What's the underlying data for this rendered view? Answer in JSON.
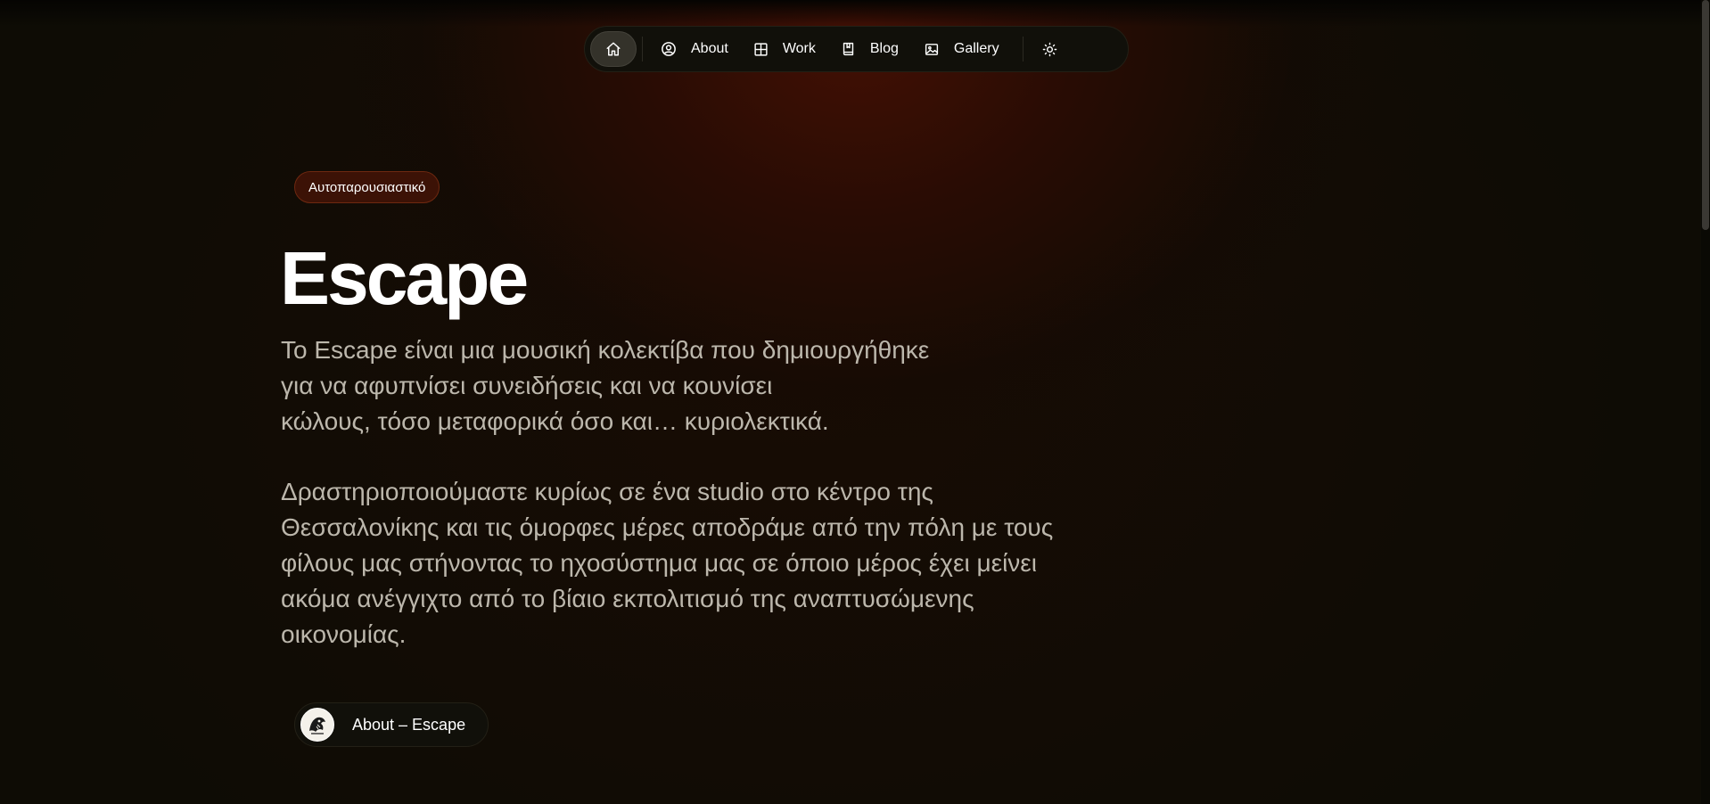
{
  "nav": {
    "home_icon": "home-icon",
    "items": [
      {
        "label": "About",
        "icon": "person-circle-icon"
      },
      {
        "label": "Work",
        "icon": "grid-icon"
      },
      {
        "label": "Blog",
        "icon": "book-icon"
      },
      {
        "label": "Gallery",
        "icon": "image-icon"
      }
    ],
    "theme_icon": "sun-icon"
  },
  "hero": {
    "badge": "Αυτοπαρουσιαστικό",
    "title": "Escape",
    "paragraph1": "Το Escape είναι μια μουσική κολεκτίβα που δημιουργήθηκε\nγια να αφυπνίσει συνειδήσεις και να κουνίσει\nκώλους, τόσο μεταφορικά όσο και… κυριολεκτικά.",
    "paragraph2": "Δραστηριοποιούμαστε κυρίως σε ένα studio στο κέντρο της\nΘεσσαλονίκης και τις όμορφες μέρες αποδράμε από την πόλη με τους\nφίλους μας στήνοντας το ηχοσύστημα μας σε όποιο μέρος έχει μείνει\nακόμα ανέγγιχτο από το βίαιο εκπολιτισμό της αναπτυσώμενης\nοικονομίας.",
    "link_label": "About – Escape"
  },
  "colors": {
    "accent": "#3c1206",
    "background": "#0e0c05",
    "text_muted": "#bcb7ac"
  }
}
